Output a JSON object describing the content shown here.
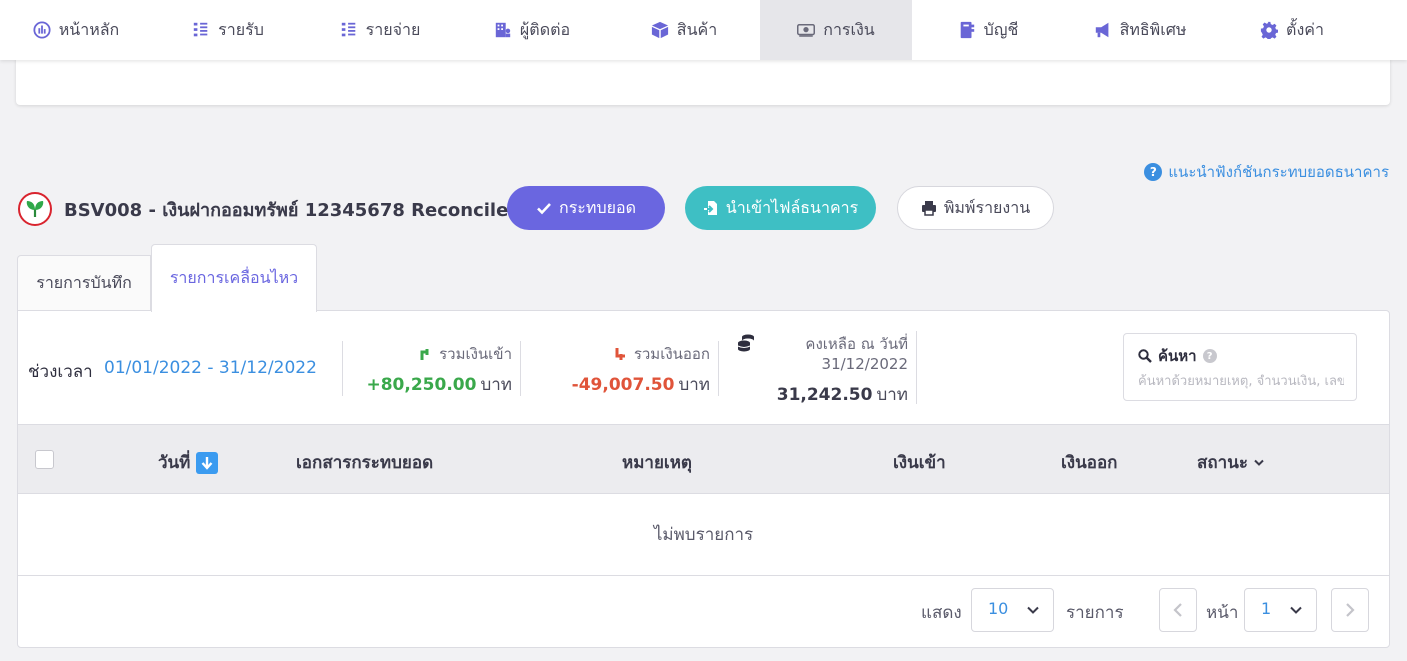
{
  "nav": {
    "items": [
      {
        "label": "หน้าหลัก",
        "icon": "dashboard-gauge-icon"
      },
      {
        "label": "รายรับ",
        "icon": "income-list-icon"
      },
      {
        "label": "รายจ่าย",
        "icon": "expense-list-icon"
      },
      {
        "label": "ผู้ติดต่อ",
        "icon": "contacts-building-icon"
      },
      {
        "label": "สินค้า",
        "icon": "product-box-icon"
      },
      {
        "label": "การเงิน",
        "icon": "finance-money-icon"
      },
      {
        "label": "บัญชี",
        "icon": "accounting-book-icon"
      },
      {
        "label": "สิทธิพิเศษ",
        "icon": "megaphone-icon"
      },
      {
        "label": "ตั้งค่า",
        "icon": "gear-icon"
      }
    ],
    "active": "การเงิน"
  },
  "help_link": "แนะนำฟังก์ชันกระทบยอดธนาคาร",
  "account": {
    "title": "BSV008 - เงินฝากออมทรัพย์ 12345678 Reconcile",
    "bank_logo": "kbank-logo",
    "brand_color": "#d9242e"
  },
  "actions": {
    "reconcile": "กระทบยอด",
    "import": "นำเข้าไฟล์ธนาคาร",
    "print": "พิมพ์รายงาน"
  },
  "tabs": {
    "records": "รายการบันทึก",
    "movements": "รายการเคลื่อนไหว",
    "active": "รายการเคลื่อนไหว"
  },
  "summary": {
    "period_label": "ช่วงเวลา",
    "period_value": "01/01/2022 - 31/12/2022",
    "total_in_label": "รวมเงินเข้า",
    "total_in_value": "+80,250.00",
    "total_out_label": "รวมเงินออก",
    "total_out_value": "-49,007.50",
    "balance_label": "คงเหลือ ณ วันที่",
    "balance_date": "31/12/2022",
    "balance_value": "31,242.50",
    "unit": "บาท"
  },
  "search": {
    "label": "ค้นหา",
    "placeholder": "ค้นหาด้วยหมายเหตุ, จำนวนเงิน, เลขที่เอกสาร"
  },
  "table": {
    "columns": {
      "date": "วันที่",
      "document": "เอกสารกระทบยอด",
      "note": "หมายเหตุ",
      "money_in": "เงินเข้า",
      "money_out": "เงินออก",
      "status": "สถานะ"
    },
    "rows": [],
    "empty_text": "ไม่พบรายการ"
  },
  "pagination": {
    "show_label": "แสดง",
    "page_size": "10",
    "items_label": "รายการ",
    "page_label": "หน้า",
    "page": "1"
  },
  "colors": {
    "accent": "#6a66e0",
    "teal": "#3ebfc4",
    "link": "#3b8fe0",
    "positive": "#3aa84b",
    "negative": "#e0543a"
  }
}
